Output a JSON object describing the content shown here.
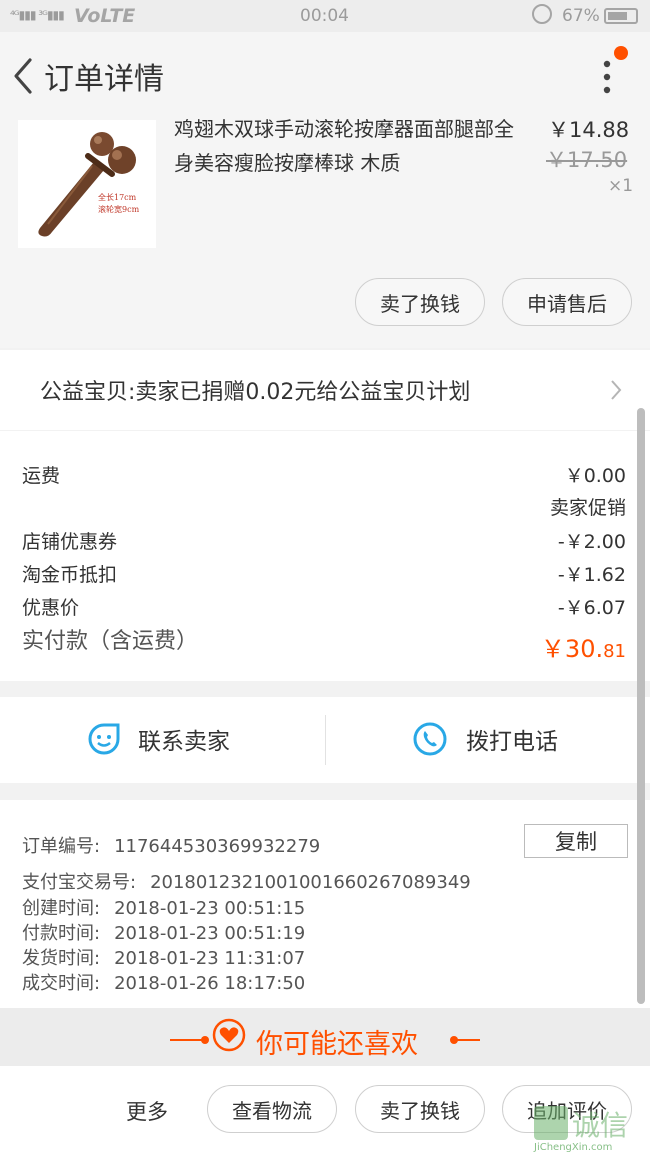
{
  "status_bar": {
    "signal": "⁴ᴳ▮▮▮ ³ᴳ▮▮▮",
    "volte": "VoLTE",
    "time": "00:04",
    "battery": "67%"
  },
  "nav": {
    "title": "订单详情"
  },
  "product": {
    "name": "鸡翅木双球手动滚轮按摩器面部腿部全身美容瘦脸按摩棒球 木质",
    "price": "￥14.88",
    "original_price": "￥17.50",
    "quantity": "×1",
    "thumb_caption_1": "全长17cm",
    "thumb_caption_2": "滚轮宽9cm",
    "sell_button": "卖了换钱",
    "aftersale_button": "申请售后"
  },
  "charity": {
    "text": "公益宝贝:卖家已捐赠0.02元给公益宝贝计划"
  },
  "fees": {
    "rows": [
      {
        "label": "运费",
        "value": "￥0.00"
      },
      {
        "label": "",
        "value": "卖家促销"
      },
      {
        "label": "店铺优惠券",
        "value": "-￥2.00"
      },
      {
        "label": "淘金币抵扣",
        "value": "-￥1.62"
      },
      {
        "label": "优惠价",
        "value": "-￥6.07"
      }
    ],
    "total_label": "实付款（含运费）",
    "total_main": "￥30.",
    "total_cents": "81"
  },
  "contact": {
    "seller": "联系卖家",
    "phone": "拨打电话"
  },
  "order_info": {
    "rows": [
      {
        "label": "订单编号:",
        "value": "117644530369932279"
      },
      {
        "label": "支付宝交易号:",
        "value": "2018012321001001660267089349"
      },
      {
        "label": "创建时间:",
        "value": "2018-01-23 00:51:15"
      },
      {
        "label": "付款时间:",
        "value": "2018-01-23 00:51:19"
      },
      {
        "label": "发货时间:",
        "value": "2018-01-23 11:31:07"
      },
      {
        "label": "成交时间:",
        "value": "2018-01-26 18:17:50"
      }
    ],
    "copy_button": "复制"
  },
  "recommend": {
    "text": "你可能还喜欢"
  },
  "bottom_bar": {
    "more": "更多",
    "logistics": "查看物流",
    "sell": "卖了换钱",
    "review": "追加评价"
  },
  "watermark": {
    "label": "诚信",
    "url": "JiChengXin.com"
  },
  "colors": {
    "accent": "#ff5000",
    "contact_icon": "#29a8e6"
  }
}
